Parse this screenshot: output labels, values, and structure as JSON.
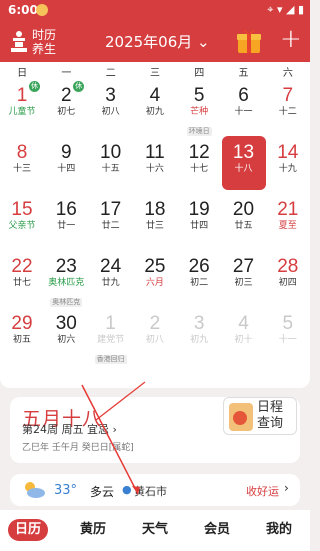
{
  "status": {
    "time": "6:00",
    "icons": "⌖ ▾ ◢ ▮"
  },
  "header": {
    "logo_line1": "时历",
    "logo_line2": "养生",
    "month": "2025年06月",
    "chevron": "⌄",
    "add": "+"
  },
  "weekdays": [
    "日",
    "一",
    "二",
    "三",
    "四",
    "五",
    "六"
  ],
  "days": [
    {
      "num": "1",
      "lunar": "儿童节",
      "numRed": true,
      "lunarClass": "green",
      "badge": "休"
    },
    {
      "num": "2",
      "lunar": "初七",
      "badge": "休"
    },
    {
      "num": "3",
      "lunar": "初八"
    },
    {
      "num": "4",
      "lunar": "初九"
    },
    {
      "num": "5",
      "lunar": "芒种",
      "lunarClass": "red",
      "tag": "环境日"
    },
    {
      "num": "6",
      "lunar": "十一"
    },
    {
      "num": "7",
      "lunar": "十二",
      "numRed": true
    },
    {
      "num": "8",
      "lunar": "十三",
      "numRed": true
    },
    {
      "num": "9",
      "lunar": "十四"
    },
    {
      "num": "10",
      "lunar": "十五"
    },
    {
      "num": "11",
      "lunar": "十六"
    },
    {
      "num": "12",
      "lunar": "十七"
    },
    {
      "num": "13",
      "lunar": "十八",
      "selected": true
    },
    {
      "num": "14",
      "lunar": "十九",
      "numRed": true
    },
    {
      "num": "15",
      "lunar": "父亲节",
      "numRed": true,
      "lunarClass": "green"
    },
    {
      "num": "16",
      "lunar": "廿一"
    },
    {
      "num": "17",
      "lunar": "廿二"
    },
    {
      "num": "18",
      "lunar": "廿三"
    },
    {
      "num": "19",
      "lunar": "廿四"
    },
    {
      "num": "20",
      "lunar": "廿五"
    },
    {
      "num": "21",
      "lunar": "夏至",
      "numRed": true,
      "lunarClass": "red"
    },
    {
      "num": "22",
      "lunar": "廿七",
      "numRed": true
    },
    {
      "num": "23",
      "lunar": "奥林匹克",
      "lunarClass": "green",
      "tag": "奥林匹克"
    },
    {
      "num": "24",
      "lunar": "廿九"
    },
    {
      "num": "25",
      "lunar": "六月",
      "lunarClass": "red"
    },
    {
      "num": "26",
      "lunar": "初二"
    },
    {
      "num": "27",
      "lunar": "初三"
    },
    {
      "num": "28",
      "lunar": "初四",
      "numRed": true
    },
    {
      "num": "29",
      "lunar": "初五",
      "numRed": true
    },
    {
      "num": "30",
      "lunar": "初六"
    },
    {
      "num": "1",
      "lunar": "建党节",
      "faded": true,
      "tag": "香港回归"
    },
    {
      "num": "2",
      "lunar": "初八",
      "faded": true
    },
    {
      "num": "3",
      "lunar": "初九",
      "faded": true
    },
    {
      "num": "4",
      "lunar": "初十",
      "faded": true
    },
    {
      "num": "5",
      "lunar": "十一",
      "faded": true
    }
  ],
  "info": {
    "lunar_date": "五月十八",
    "week_line": "第24周 周五 宜忌 ›",
    "ganzhi": "乙巳年 壬午月 癸巳日[属蛇]",
    "schedule_line1": "日程",
    "schedule_line2": "查询"
  },
  "weather": {
    "temp": "33°",
    "condition": "多云",
    "location": "黄石市",
    "fortune": "收好运",
    "chevron": "›"
  },
  "tabs": [
    "日历",
    "黄历",
    "天气",
    "会员",
    "我的"
  ],
  "colors": {
    "accent": "#d63d3f",
    "green": "#2a9d4a"
  }
}
